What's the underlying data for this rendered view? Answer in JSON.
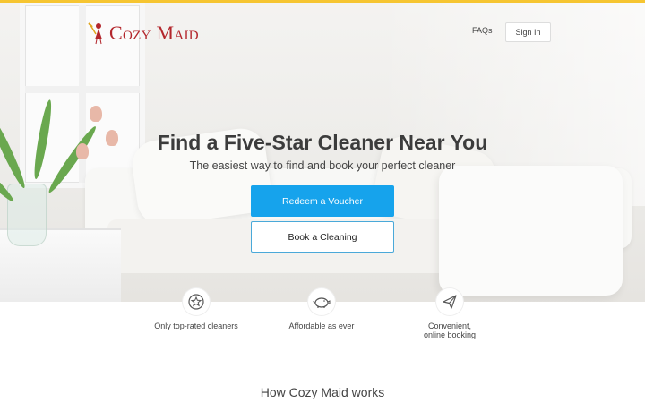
{
  "header": {
    "logo_text": "Cozy Maid",
    "nav": {
      "faqs": "FAQs",
      "sign_in": "Sign In"
    }
  },
  "hero": {
    "title": "Find a Five-Star Cleaner Near You",
    "subtitle": "The easiest way to find and book your perfect cleaner",
    "primary_button": "Redeem a Voucher",
    "secondary_button": "Book a Cleaning"
  },
  "features": [
    {
      "icon": "star-badge-icon",
      "label": "Only top-rated cleaners"
    },
    {
      "icon": "piggy-bank-icon",
      "label": "Affordable as ever"
    },
    {
      "icon": "paper-plane-icon",
      "label_line1": "Convenient,",
      "label_line2": "online booking"
    }
  ],
  "how_it_works": {
    "heading": "How Cozy Maid works"
  },
  "colors": {
    "accent_bar": "#f6c531",
    "brand": "#b3262c",
    "primary_button": "#16a3ec",
    "secondary_border": "#4aa9d9"
  }
}
